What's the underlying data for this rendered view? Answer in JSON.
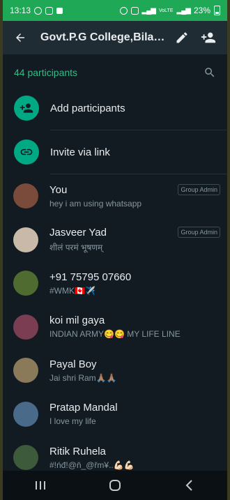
{
  "status_bar": {
    "time": "13:13",
    "battery": "23%",
    "network": "VoLTE"
  },
  "header": {
    "title": "Govt.P.G College,Bila…"
  },
  "participants": {
    "count_label": "44 participants"
  },
  "actions": [
    {
      "label": "Add participants",
      "icon": "add-person-icon"
    },
    {
      "label": "Invite via link",
      "icon": "link-icon"
    }
  ],
  "members": [
    {
      "name": "You",
      "about": "hey i am using whatsapp",
      "badge": "Group Admin",
      "avatar_color": "#7a4a3a"
    },
    {
      "name": "Jasveer Yad",
      "about": "शीलं परमं भूषणम्",
      "badge": "Group Admin",
      "avatar_color": "#c9b9a8"
    },
    {
      "name": "+91 75795 07660",
      "about": "#WMK🇨🇦✈️",
      "badge": "",
      "avatar_color": "#4f6b2f"
    },
    {
      "name": "koi mil gaya",
      "about": "INDIAN ARMY😋😋 MY LIFE LINE",
      "badge": "",
      "avatar_color": "#7a3d52"
    },
    {
      "name": "Payal Boy",
      "about": "Jai shri Ram🙏🏽🙏🏽",
      "badge": "",
      "avatar_color": "#8a7a5a"
    },
    {
      "name": "Pratap Mandal",
      "about": "I love my life",
      "badge": "",
      "avatar_color": "#4a6a8a"
    },
    {
      "name": "Ritik Ruhela",
      "about": "#!ńđ!@ň_@řm¥..💪🏻💪🏻",
      "badge": "",
      "avatar_color": "#3d5a3a"
    }
  ],
  "colors": {
    "accent": "#00a884",
    "status_bar": "#1fa855",
    "appbar": "#1f2c34",
    "background": "#121b22"
  }
}
